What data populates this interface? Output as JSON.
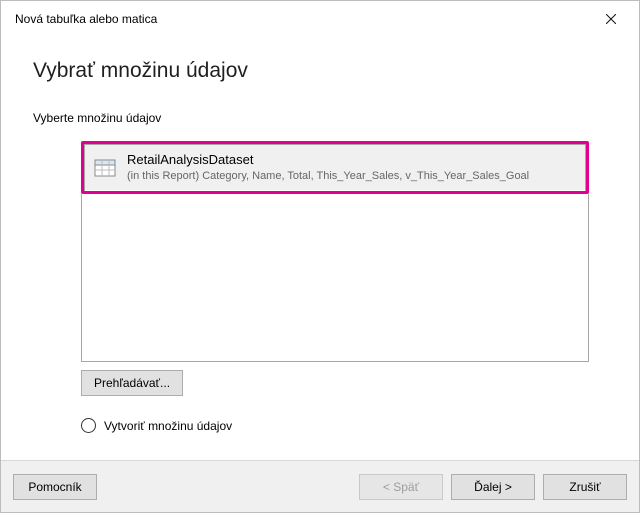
{
  "titlebar": {
    "title": "Nová tabuľka alebo matica"
  },
  "heading": "Vybrať množinu údajov",
  "subheading": "Vyberte množinu údajov",
  "dataset": {
    "name": "RetailAnalysisDataset",
    "fields": "(in this Report) Category, Name, Total, This_Year_Sales, v_This_Year_Sales_Goal"
  },
  "buttons": {
    "browse": "Prehľadávať...",
    "create_dataset": "Vytvoriť množinu údajov",
    "help": "Pomocník",
    "back": "< Späť",
    "next": "Ďalej >",
    "cancel": "Zrušiť"
  }
}
